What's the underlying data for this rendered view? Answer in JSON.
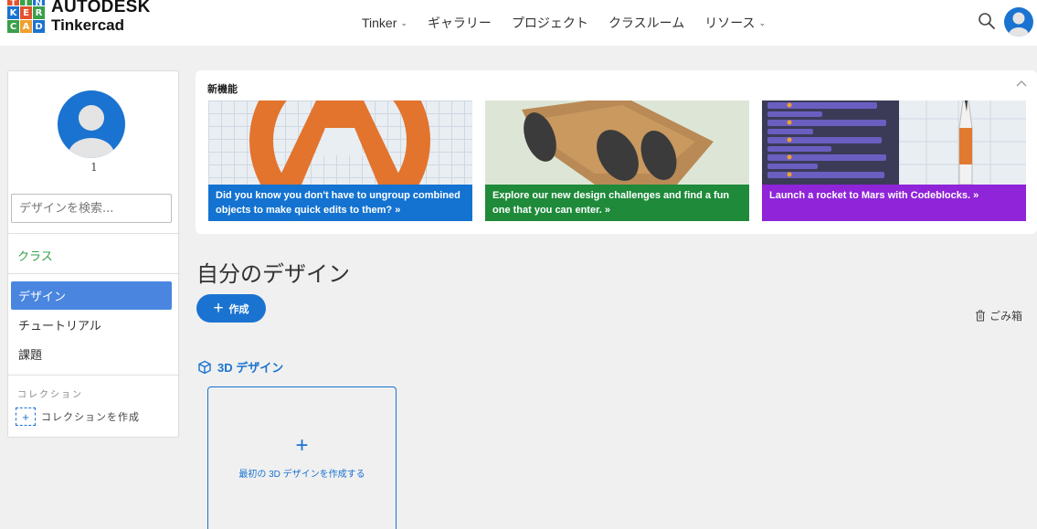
{
  "brand": {
    "logo_letters": [
      "T",
      "I",
      "N",
      "K",
      "E",
      "R",
      "C",
      "A",
      "D"
    ],
    "company": "AUTODESK",
    "product": "Tinkercad"
  },
  "nav": {
    "items": [
      {
        "label": "Tinker",
        "dropdown": true
      },
      {
        "label": "ギャラリー",
        "dropdown": false
      },
      {
        "label": "プロジェクト",
        "dropdown": false
      },
      {
        "label": "クラスルーム",
        "dropdown": false
      },
      {
        "label": "リソース",
        "dropdown": true
      }
    ],
    "search_icon": "search-icon",
    "avatar_icon": "user-avatar-icon"
  },
  "sidebar": {
    "profile_count": "1",
    "search_placeholder": "デザインを検索...",
    "class_label": "クラス",
    "items": [
      {
        "label": "デザイン",
        "active": true
      },
      {
        "label": "チュートリアル",
        "active": false
      },
      {
        "label": "課題",
        "active": false
      }
    ],
    "collections_heading": "コレクション",
    "create_collection_label": "コレクションを作成"
  },
  "whats_new": {
    "title": "新機能",
    "cards": [
      {
        "caption": "Did you know you don't have to ungroup combined objects to make quick edits to them? »",
        "color": "#1473d1"
      },
      {
        "caption": "Explore our new design challenges and find a fun one that you can enter. »",
        "color": "#1e8a3a"
      },
      {
        "caption": "Launch a rocket to Mars with Codeblocks. »",
        "color": "#8f24d8"
      }
    ]
  },
  "main": {
    "heading": "自分のデザイン",
    "create_label": "作成",
    "trash_label": "ごみ箱",
    "section_title": "3D デザイン",
    "create_first_label": "最初の 3D デザインを作成する"
  },
  "colors": {
    "accent": "#1a73d0",
    "class_green": "#3aa04a",
    "active_item": "#4a86e0"
  }
}
